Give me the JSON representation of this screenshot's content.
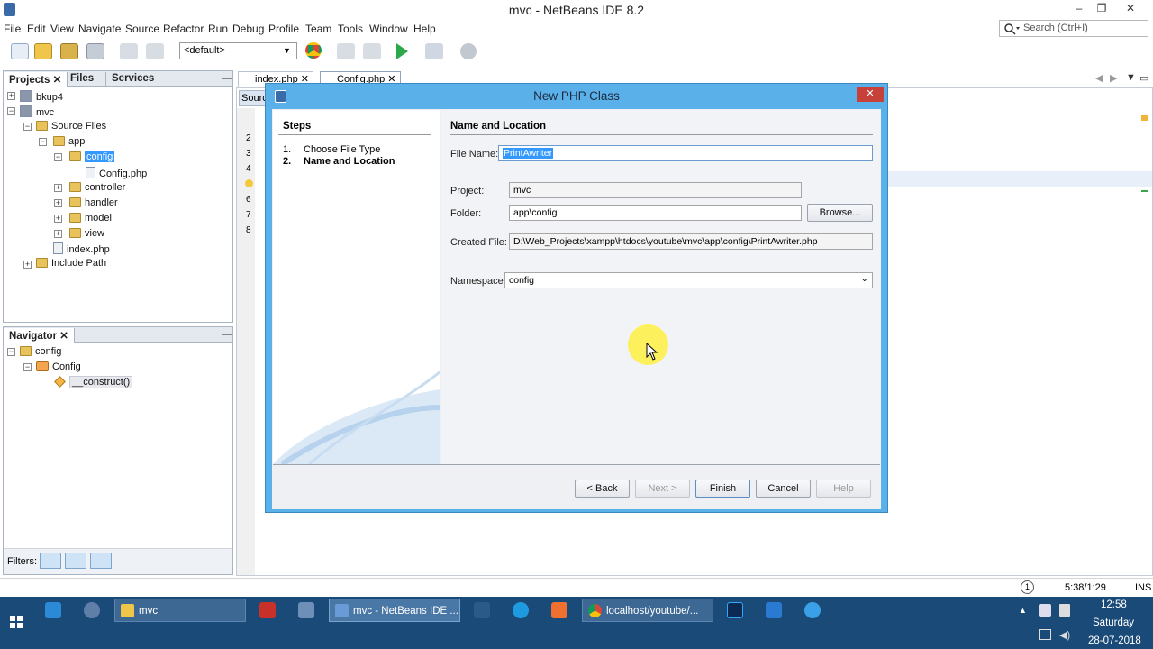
{
  "window": {
    "title": "mvc - NetBeans IDE 8.2",
    "min": "–",
    "max": "❐",
    "close": "✕"
  },
  "menu": [
    "File",
    "Edit",
    "View",
    "Navigate",
    "Source",
    "Refactor",
    "Run",
    "Debug",
    "Profile",
    "Team",
    "Tools",
    "Window",
    "Help"
  ],
  "search": {
    "placeholder": "Search (Ctrl+I)"
  },
  "toolbar": {
    "config": "<default>"
  },
  "projects_panel": {
    "tabs": [
      "Projects",
      "Files",
      "Services"
    ],
    "tree": [
      "bkup4",
      "mvc",
      "Source Files",
      "app",
      "config",
      "Config.php",
      "controller",
      "handler",
      "model",
      "view",
      "index.php",
      "Include Path"
    ]
  },
  "navigator": {
    "title": "Navigator",
    "tree": [
      "config",
      "Config",
      "__construct()"
    ]
  },
  "filters": {
    "label": "Filters:"
  },
  "editor": {
    "tabs": [
      "index.php",
      "Config.php"
    ],
    "source_tab": "Sourc",
    "line_numbers": [
      "2",
      "3",
      "4",
      "",
      "6",
      "7",
      "8"
    ]
  },
  "dialog": {
    "title": "New PHP Class",
    "steps_header": "Steps",
    "steps": [
      {
        "num": "1.",
        "label": "Choose File Type"
      },
      {
        "num": "2.",
        "label": "Name and Location"
      }
    ],
    "section": "Name and Location",
    "file_name_label": "File Name:",
    "file_name": "PrintAwriter",
    "project_label": "Project:",
    "project": "mvc",
    "folder_label": "Folder:",
    "folder": "app\\config",
    "browse": "Browse...",
    "created_label": "Created File:",
    "created_file": "D:\\Web_Projects\\xampp\\htdocs\\youtube\\mvc\\app\\config\\PrintAwriter.php",
    "namespace_label": "Namespace:",
    "namespace": "config",
    "buttons": {
      "back": "< Back",
      "next": "Next >",
      "finish": "Finish",
      "cancel": "Cancel",
      "help": "Help"
    }
  },
  "status": {
    "position": "5:38/1:29",
    "mode": "INS"
  },
  "taskbar": {
    "items": [
      "mvc",
      "mvc - NetBeans IDE ...",
      "localhost/youtube/..."
    ],
    "time": "12:58",
    "day": "Saturday",
    "date": "28-07-2018"
  },
  "colors": {
    "accent": "#3399ff",
    "dialog_frame": "#5ab0e8",
    "taskbar": "#1a4a78",
    "selection": "#3399ff"
  }
}
